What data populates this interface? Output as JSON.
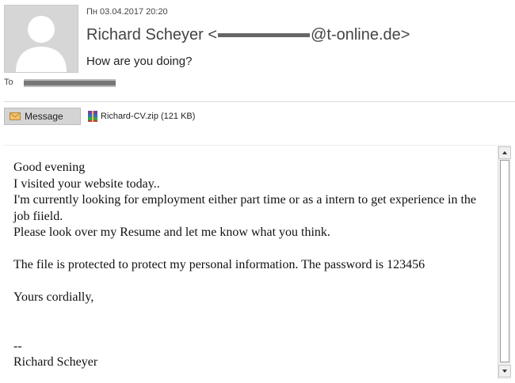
{
  "header": {
    "datetime": "Пн 03.04.2017 20:20",
    "sender_name": "Richard Scheyer",
    "sender_open": "<",
    "sender_domain": "@t-online.de",
    "sender_close": ">",
    "subject": "How are you doing?",
    "to_label": "To"
  },
  "attachments_bar": {
    "message_tab": "Message",
    "attachment_name": "Richard-CV.zip (121 KB)",
    "icons": {
      "message": "envelope-icon",
      "attachment": "zip-archive-icon",
      "avatar": "person-icon"
    }
  },
  "email_body": {
    "lines": [
      "Good evening",
      "I visited your website today..",
      "I'm currently looking for employment either part time or as a intern to get experience in the job fiield.",
      "Please look over my Resume and let me know what you think.",
      "",
      "The file is protected to protect my personal information. The password is 123456",
      "",
      "Yours cordially,",
      "",
      "",
      "--",
      "Richard Scheyer"
    ]
  }
}
